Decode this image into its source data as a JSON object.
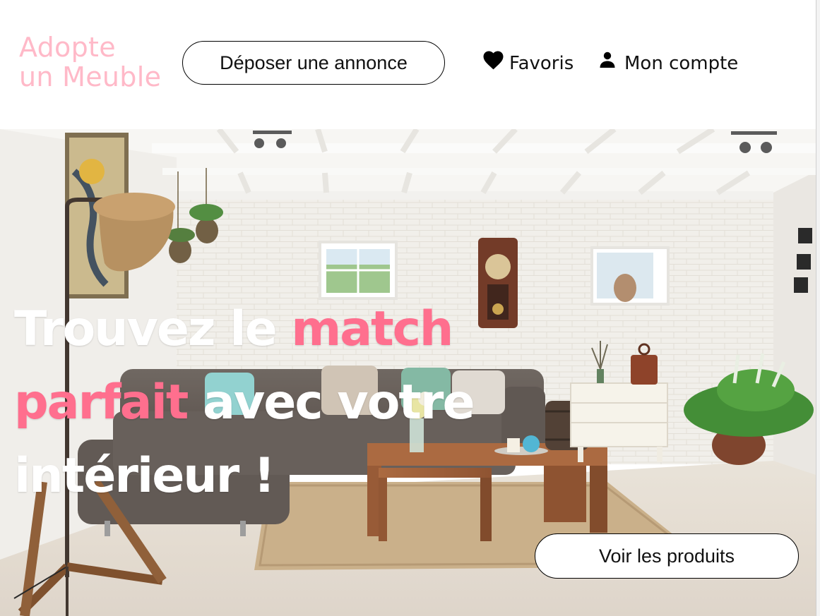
{
  "header": {
    "logo_line1": "Adopte",
    "logo_line2": "un Meuble",
    "post_button": "Déposer une annonce",
    "favorites_label": "Favoris",
    "favorites_icon": "heart-icon",
    "account_label": "Mon compte",
    "account_icon": "user-icon"
  },
  "hero": {
    "headline_part1": "Trouvez le ",
    "headline_highlight1": "match",
    "headline_highlight2": "parfait",
    "headline_part2": " avec votre",
    "headline_part3": "intérieur !",
    "cta_button": "Voir les produits"
  },
  "colors": {
    "logo": "#ffb9c8",
    "accent": "#ff6f8e",
    "text": "#111111",
    "headline": "#ffffff"
  }
}
